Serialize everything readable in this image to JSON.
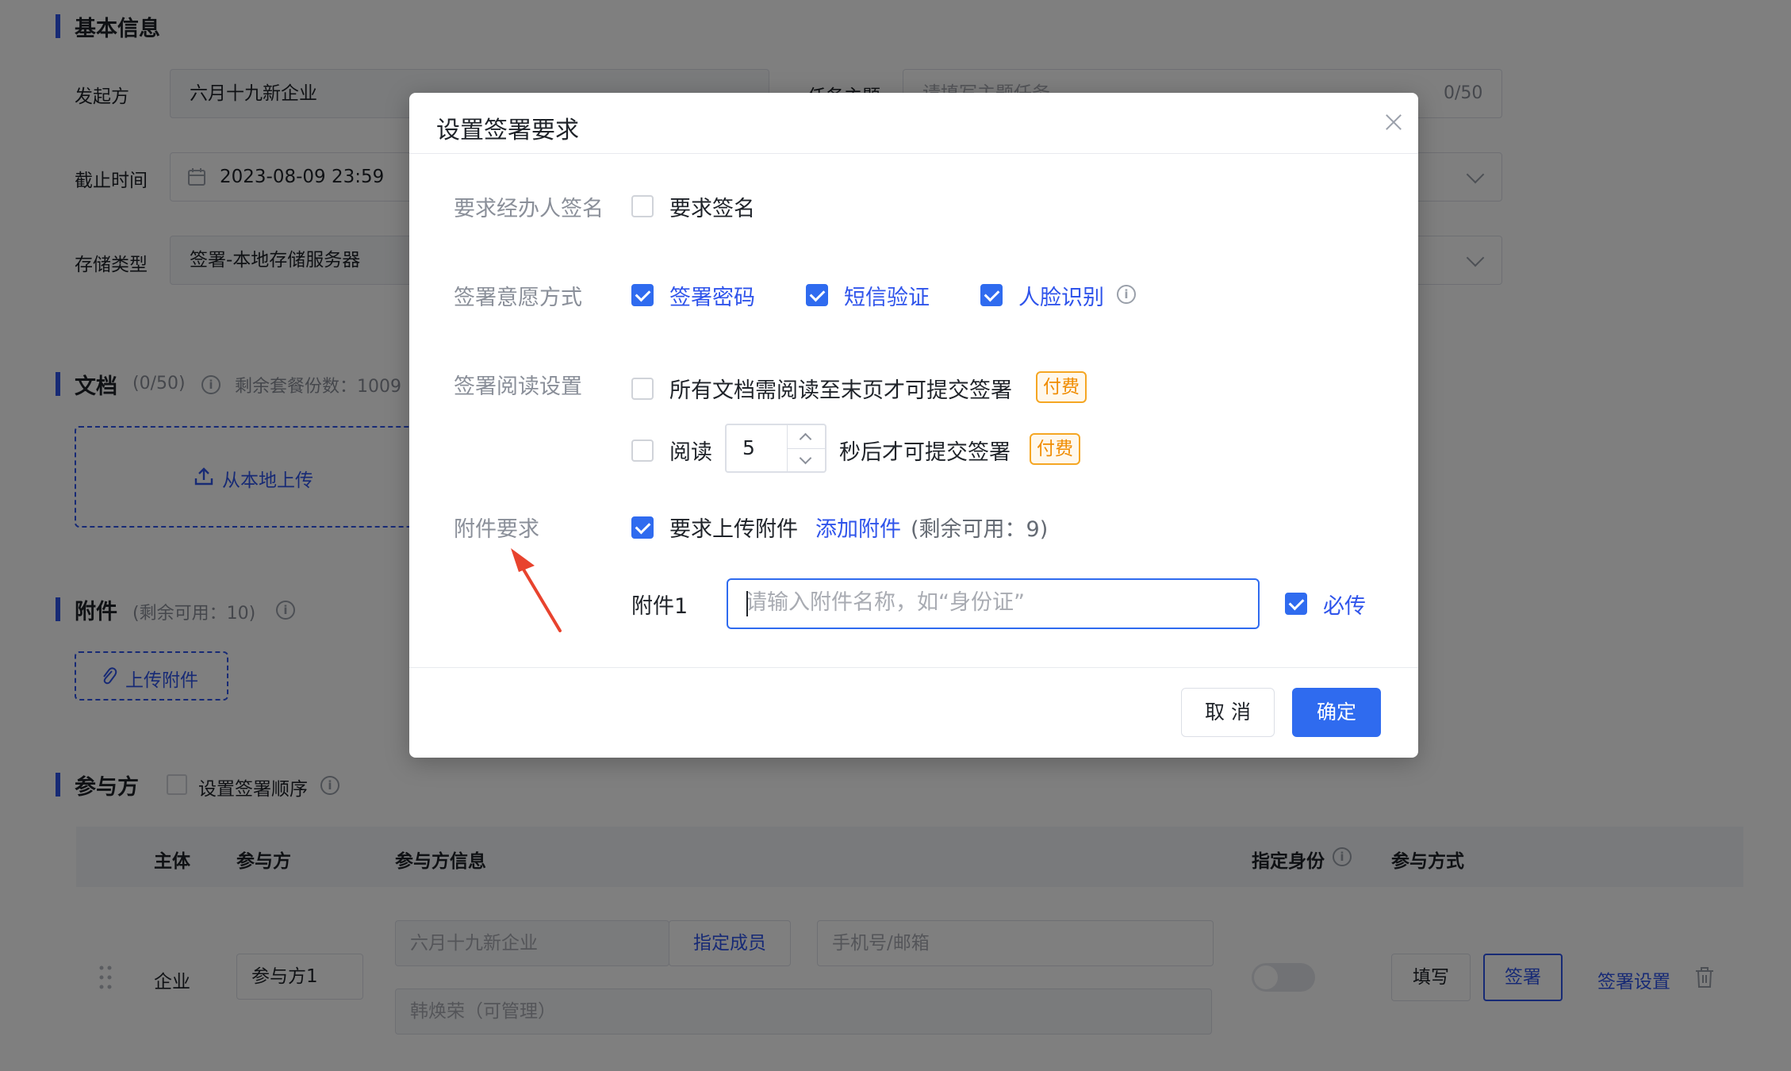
{
  "basic_section": {
    "title": "基本信息",
    "initiator_label": "发起方",
    "initiator_value": "六月十九新企业",
    "task_subject_label": "任务主题",
    "task_subject_placeholder": "请填写主题任务",
    "task_subject_count": "0/50",
    "deadline_label": "截止时间",
    "deadline_value": "2023-08-09 23:59",
    "storage_label": "存储类型",
    "storage_value": "签署-本地存储服务器"
  },
  "documents_section": {
    "title": "文档",
    "count": "(0/50)",
    "remaining": "剩余套餐份数：1009",
    "upload_local": "从本地上传"
  },
  "attachments_section": {
    "title": "附件",
    "remaining": "(剩余可用：10)",
    "upload_button": "上传附件"
  },
  "participants_section": {
    "title": "参与方",
    "set_order": "设置签署顺序",
    "headers": {
      "subject": "主体",
      "party": "参与方",
      "party_info": "参与方信息",
      "assign_identity": "指定身份",
      "method": "参与方式"
    },
    "row": {
      "subject": "企业",
      "party": "参与方1",
      "company": "六月十九新企业",
      "assign_member": "指定成员",
      "phone_placeholder": "手机号/邮箱",
      "person": "韩焕荣（可管理）",
      "fill": "填写",
      "sign": "签署",
      "sign_settings": "签署设置"
    }
  },
  "modal": {
    "title": "设置签署要求",
    "require_handler_sign": {
      "label": "要求经办人签名",
      "option": "要求签名",
      "checked": false
    },
    "intent_method": {
      "label": "签署意愿方式",
      "options": [
        {
          "label": "签署密码",
          "checked": true
        },
        {
          "label": "短信验证",
          "checked": true
        },
        {
          "label": "人脸识别",
          "checked": true
        }
      ]
    },
    "reading_settings": {
      "label": "签署阅读设置",
      "read_to_end": "所有文档需阅读至末页才可提交签署",
      "paid_badge": "付费",
      "read_prefix": "阅读",
      "read_seconds": "5",
      "read_suffix": "秒后才可提交签署"
    },
    "attachment_req": {
      "label": "附件要求",
      "require_upload": "要求上传附件",
      "add_attachment": "添加附件",
      "remaining": "(剩余可用：9)",
      "item_label": "附件1",
      "item_placeholder": "请输入附件名称，如“身份证”",
      "required_label": "必传"
    },
    "cancel_label": "取 消",
    "confirm_label": "确定"
  },
  "colors": {
    "primary": "#2f6bef",
    "paid_badge": "#f08c00",
    "annotation_arrow": "#e8432e"
  }
}
